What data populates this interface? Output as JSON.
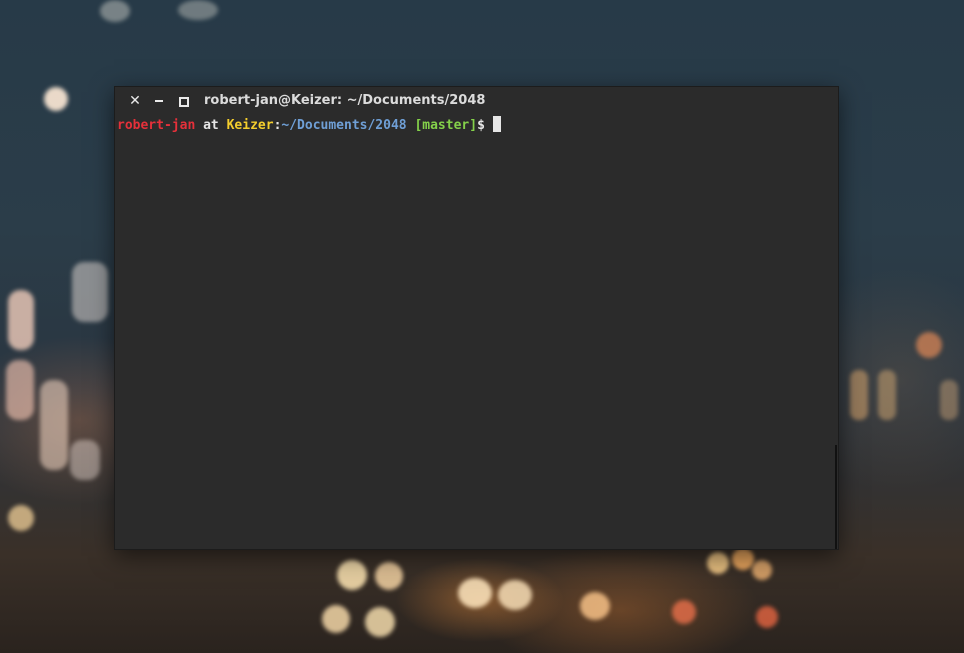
{
  "window": {
    "title": "robert-jan@Keizer: ~/Documents/2048",
    "buttons": {
      "close_icon": "close-icon",
      "minimize_icon": "minimize-icon",
      "maximize_icon": "maximize-icon"
    }
  },
  "terminal": {
    "prompt": {
      "user": "robert-jan",
      "at": " at ",
      "host": "Keizer",
      "colon": ":",
      "path": "~/Documents/2048",
      "branch": " [master]",
      "symbol": "$"
    }
  },
  "colors": {
    "user": "#e5303a",
    "host": "#f4ce2d",
    "path": "#6f9fd6",
    "branch": "#84d14a",
    "terminal_bg": "#2b2b2b"
  }
}
